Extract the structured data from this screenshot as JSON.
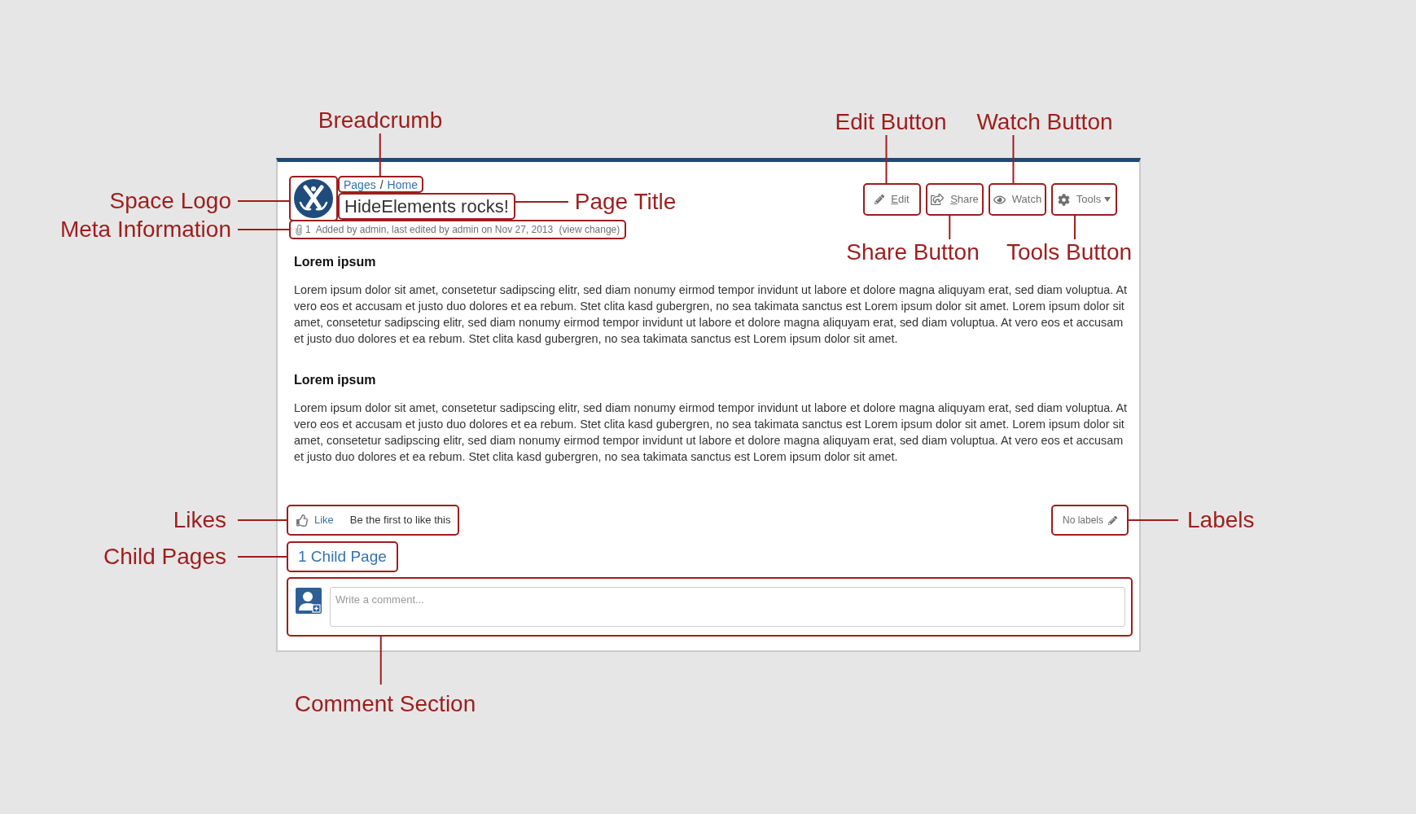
{
  "space_logo": {
    "callout": "Space Logo"
  },
  "breadcrumb": {
    "items": [
      "Pages",
      "Home"
    ],
    "separator": "/",
    "callout": "Breadcrumb"
  },
  "page_title": {
    "text": "HideElements rocks!",
    "callout": "Page Title"
  },
  "meta": {
    "attachments": "1",
    "text": "Added by admin, last edited by admin on Nov 27, 2013",
    "link": "(view change)",
    "callout": "Meta Information"
  },
  "actions": [
    {
      "kind": "edit",
      "label": "Edit",
      "mnemonic": true,
      "dropdown": false,
      "callout": "Edit Button"
    },
    {
      "kind": "share",
      "label": "Share",
      "mnemonic": true,
      "dropdown": false,
      "callout": "Share Button"
    },
    {
      "kind": "watch",
      "label": "Watch",
      "mnemonic": false,
      "dropdown": false,
      "callout": "Watch Button"
    },
    {
      "kind": "tools",
      "label": "Tools",
      "mnemonic": false,
      "dropdown": true,
      "callout": "Tools Button"
    }
  ],
  "content": [
    {
      "heading": "Lorem ipsum",
      "paragraph": "Lorem ipsum dolor sit amet, consetetur sadipscing elitr, sed diam nonumy eirmod tempor invidunt ut labore et dolore magna aliquyam erat, sed diam voluptua. At vero eos et accusam et justo duo dolores et ea rebum. Stet clita kasd gubergren, no sea takimata sanctus est Lorem ipsum dolor sit amet. Lorem ipsum dolor sit amet, consetetur sadipscing elitr, sed diam nonumy eirmod tempor invidunt ut labore et dolore magna aliquyam erat, sed diam voluptua. At vero eos et accusam et justo duo dolores et ea rebum. Stet clita kasd gubergren, no sea takimata sanctus est Lorem ipsum dolor sit amet."
    },
    {
      "heading": "Lorem ipsum",
      "paragraph": "Lorem ipsum dolor sit amet, consetetur sadipscing elitr, sed diam nonumy eirmod tempor invidunt ut labore et dolore magna aliquyam erat, sed diam voluptua. At vero eos et accusam et justo duo dolores et ea rebum. Stet clita kasd gubergren, no sea takimata sanctus est Lorem ipsum dolor sit amet. Lorem ipsum dolor sit amet, consetetur sadipscing elitr, sed diam nonumy eirmod tempor invidunt ut labore et dolore magna aliquyam erat, sed diam voluptua. At vero eos et accusam et justo duo dolores et ea rebum. Stet clita kasd gubergren, no sea takimata sanctus est Lorem ipsum dolor sit amet."
    }
  ],
  "likes": {
    "action": "Like",
    "summary": "Be the first to like this",
    "callout": "Likes"
  },
  "labels": {
    "text": "No labels",
    "callout": "Labels"
  },
  "child_pages": {
    "text": "1 Child Page",
    "callout": "Child Pages"
  },
  "comment": {
    "placeholder": "Write a comment...",
    "callout": "Comment Section"
  }
}
